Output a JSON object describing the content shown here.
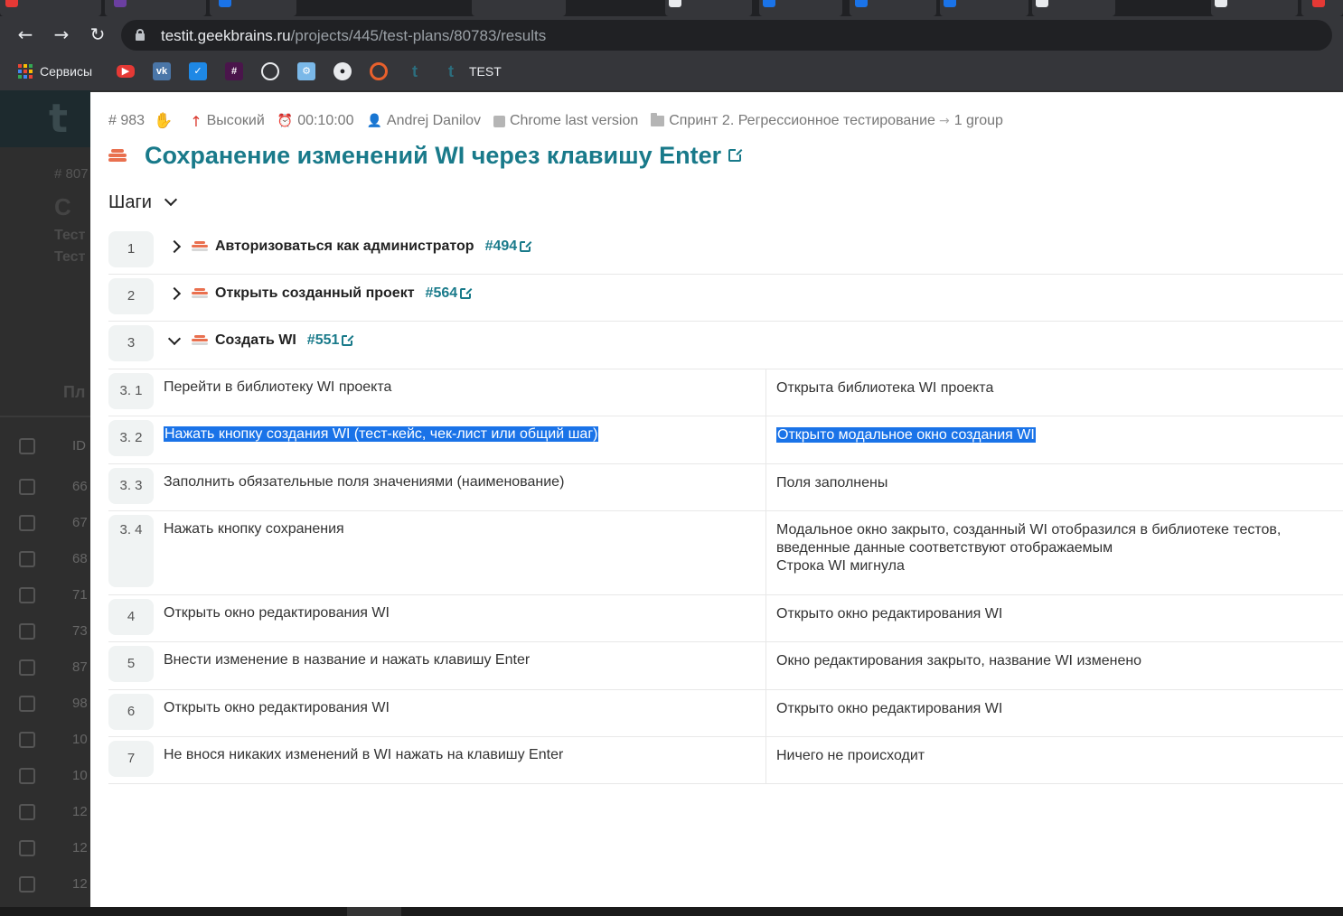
{
  "browser": {
    "url_host": "testit.geekbrains.ru",
    "url_path": "/projects/445/test-plans/80783/results",
    "bookmarks": [
      {
        "name": "apps",
        "label": "Сервисы"
      },
      {
        "name": "youtube",
        "label": ""
      },
      {
        "name": "vk",
        "label": ""
      },
      {
        "name": "tasks",
        "label": ""
      },
      {
        "name": "slack",
        "label": ""
      },
      {
        "name": "openai",
        "label": ""
      },
      {
        "name": "jira",
        "label": ""
      },
      {
        "name": "github",
        "label": ""
      },
      {
        "name": "target",
        "label": ""
      },
      {
        "name": "testit-1",
        "label": ""
      },
      {
        "name": "testit-2",
        "label": "TEST"
      }
    ],
    "colors": {
      "bg": "#202124",
      "toolbar": "#35363a",
      "accent": "#1a73e8"
    }
  },
  "background_page": {
    "id_fragment": "# 807",
    "title_fragment": "С",
    "line1": "Тест",
    "line2": "Тест",
    "tab_fragment": "Пл",
    "col_id": "ID",
    "row_ids": [
      "66",
      "67",
      "68",
      "71",
      "73",
      "87",
      "98",
      "10",
      "10",
      "12",
      "12",
      "12"
    ]
  },
  "test_case": {
    "id": "# 983",
    "priority": "Высокий",
    "duration": "00:10:00",
    "author": "Andrej Danilov",
    "configuration": "Chrome last version",
    "section": "Спринт 2. Регрессионное тестирование",
    "subsection": "1 group",
    "title": "Сохранение изменений WI через клавишу Enter",
    "accent_color": "#197a8a",
    "priority_color": "#d9362b"
  },
  "steps_section": {
    "label": "Шаги"
  },
  "steps": {
    "s1": {
      "num": "1",
      "title": "Авторизоваться как администратор",
      "link": "#494"
    },
    "s2": {
      "num": "2",
      "title": "Открыть созданный проект",
      "link": "#564"
    },
    "s3": {
      "num": "3",
      "title": "Создать WI",
      "link": "#551"
    },
    "s3_1": {
      "num": "3. 1",
      "action": "Перейти в библиотеку WI проекта",
      "expected": "Открыта библиотека WI проекта"
    },
    "s3_2": {
      "num": "3. 2",
      "action": "Нажать кнопку создания WI (тест-кейс, чек-лист или общий шаг)",
      "expected": "Открыто модальное окно создания WI"
    },
    "s3_3": {
      "num": "3. 3",
      "action": "Заполнить обязательные поля значениями (наименование)",
      "expected": "Поля заполнены"
    },
    "s3_4": {
      "num": "3. 4",
      "action": "Нажать кнопку сохранения",
      "expected_l1": "Модальное окно закрыто, созданный WI отобразился в библиотеке тестов,",
      "expected_l2": "введенные данные соответствуют отображаемым",
      "expected_l3": "Строка WI мигнула"
    },
    "s4": {
      "num": "4",
      "action": "Открыть окно редактирования WI",
      "expected": "Открыто окно редактирования WI"
    },
    "s5": {
      "num": "5",
      "action": "Внести изменение в название и нажать клавишу Enter",
      "expected": "Окно редактирования закрыто, название WI изменено"
    },
    "s6": {
      "num": "6",
      "action": "Открыть окно редактирования WI",
      "expected": "Открыто окно редактирования WI"
    },
    "s7": {
      "num": "7",
      "action": "Не внося никаких изменений в WI нажать на клавишу Enter",
      "expected": "Ничего не происходит"
    }
  }
}
